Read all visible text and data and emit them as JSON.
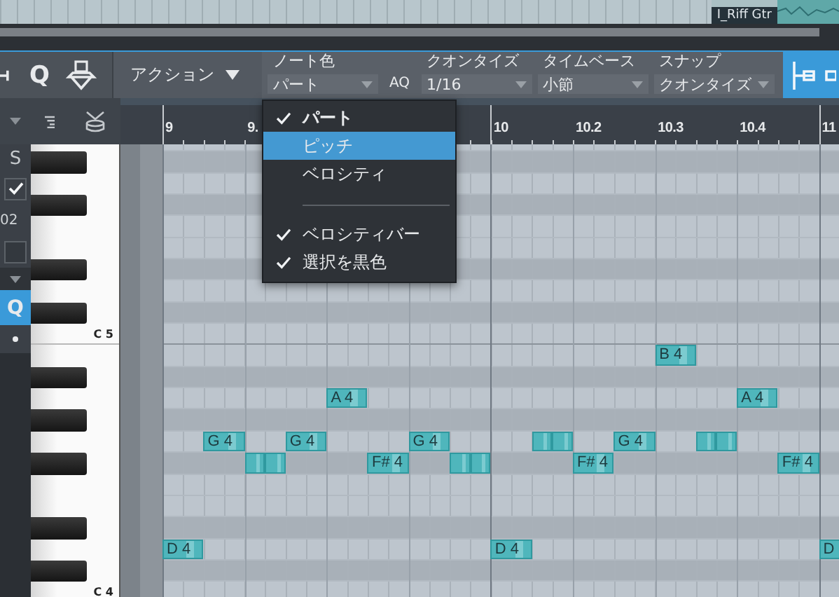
{
  "arrange_track": {
    "clip_label": "I_Riff Gtr"
  },
  "toolbar": {
    "tool_q": "Q",
    "action_menu": "アクション",
    "aq_button": "AQ",
    "fields": [
      {
        "label": "ノート色",
        "value": "パート"
      },
      {
        "label": "クオンタイズ",
        "value": "1/16"
      },
      {
        "label": "タイムベース",
        "value": "小節"
      },
      {
        "label": "スナップ",
        "value": "クオンタイズ"
      }
    ]
  },
  "note_color_menu": {
    "items": [
      {
        "kind": "option",
        "label": "パート",
        "checked": true,
        "selected": false
      },
      {
        "kind": "option",
        "label": "ピッチ",
        "checked": false,
        "selected": true
      },
      {
        "kind": "option",
        "label": "ベロシティ",
        "checked": false,
        "selected": false
      },
      {
        "kind": "separator"
      },
      {
        "kind": "option",
        "label": "ベロシティバー",
        "checked": true,
        "selected": false
      },
      {
        "kind": "option",
        "label": "選択を黒色",
        "checked": true,
        "selected": false
      }
    ]
  },
  "side_tools": [
    {
      "kind": "text-button",
      "label": "S"
    },
    {
      "kind": "checkbox",
      "checked": true
    },
    {
      "kind": "readout",
      "label": "02"
    },
    {
      "kind": "checkbox",
      "checked": false
    },
    {
      "kind": "collapse"
    },
    {
      "kind": "toggle",
      "label": "Q",
      "on": true
    },
    {
      "kind": "dot"
    }
  ],
  "ruler": {
    "beats": [
      {
        "kind": "bar",
        "label": "9"
      },
      {
        "kind": "beat",
        "label": "9."
      },
      {
        "kind": "covered"
      },
      {
        "kind": "covered"
      },
      {
        "kind": "bar",
        "label": "10"
      },
      {
        "kind": "beat",
        "label": "10.2"
      },
      {
        "kind": "beat",
        "label": "10.3"
      },
      {
        "kind": "beat",
        "label": "10.4"
      },
      {
        "kind": "bar",
        "label": "11"
      }
    ]
  },
  "lanes": [
    {
      "kind": "white"
    },
    {
      "kind": "black"
    },
    {
      "kind": "white"
    },
    {
      "kind": "black"
    },
    {
      "kind": "white"
    },
    {
      "kind": "white"
    },
    {
      "kind": "black"
    },
    {
      "kind": "white"
    },
    {
      "kind": "black"
    },
    {
      "kind": "white",
      "key_label": "C 5",
      "octave_line": true
    },
    {
      "kind": "white",
      "slots": [
        {
          "kind": "empty"
        },
        {
          "kind": "empty"
        },
        {
          "kind": "empty"
        },
        {
          "kind": "empty"
        },
        {
          "kind": "empty"
        },
        {
          "kind": "empty"
        },
        {
          "kind": "empty"
        },
        {
          "kind": "empty"
        },
        {
          "kind": "empty"
        },
        {
          "kind": "empty"
        },
        {
          "kind": "empty"
        },
        {
          "kind": "empty"
        },
        {
          "kind": "note",
          "label": "B 4"
        }
      ]
    },
    {
      "kind": "black"
    },
    {
      "kind": "white",
      "slots": [
        {
          "kind": "empty"
        },
        {
          "kind": "empty"
        },
        {
          "kind": "empty"
        },
        {
          "kind": "empty"
        },
        {
          "kind": "note",
          "label": "A 4"
        },
        {
          "kind": "empty"
        },
        {
          "kind": "empty"
        },
        {
          "kind": "empty"
        },
        {
          "kind": "empty"
        },
        {
          "kind": "empty"
        },
        {
          "kind": "empty"
        },
        {
          "kind": "empty"
        },
        {
          "kind": "empty"
        },
        {
          "kind": "empty"
        },
        {
          "kind": "note",
          "label": "A 4"
        }
      ]
    },
    {
      "kind": "black"
    },
    {
      "kind": "white",
      "slots": [
        {
          "kind": "empty"
        },
        {
          "kind": "note",
          "label": "G 4"
        },
        {
          "kind": "empty"
        },
        {
          "kind": "note",
          "label": "G 4"
        },
        {
          "kind": "empty"
        },
        {
          "kind": "empty"
        },
        {
          "kind": "note",
          "label": "G 4"
        },
        {
          "kind": "empty"
        },
        {
          "kind": "empty"
        },
        {
          "kind": "pair"
        },
        {
          "kind": "empty"
        },
        {
          "kind": "note",
          "label": "G 4"
        },
        {
          "kind": "empty"
        },
        {
          "kind": "pair"
        }
      ]
    },
    {
      "kind": "black",
      "slots": [
        {
          "kind": "empty"
        },
        {
          "kind": "empty"
        },
        {
          "kind": "pair"
        },
        {
          "kind": "empty"
        },
        {
          "kind": "empty"
        },
        {
          "kind": "note",
          "label": "F# 4"
        },
        {
          "kind": "empty"
        },
        {
          "kind": "pair"
        },
        {
          "kind": "empty"
        },
        {
          "kind": "empty"
        },
        {
          "kind": "note",
          "label": "F# 4"
        },
        {
          "kind": "empty"
        },
        {
          "kind": "empty"
        },
        {
          "kind": "empty"
        },
        {
          "kind": "empty"
        },
        {
          "kind": "note",
          "label": "F# 4"
        }
      ]
    },
    {
      "kind": "white"
    },
    {
      "kind": "white"
    },
    {
      "kind": "black"
    },
    {
      "kind": "white",
      "slots": [
        {
          "kind": "note",
          "label": "D 4"
        },
        {
          "kind": "empty"
        },
        {
          "kind": "empty"
        },
        {
          "kind": "empty"
        },
        {
          "kind": "empty"
        },
        {
          "kind": "empty"
        },
        {
          "kind": "empty"
        },
        {
          "kind": "empty"
        },
        {
          "kind": "note",
          "label": "D 4"
        },
        {
          "kind": "empty"
        },
        {
          "kind": "empty"
        },
        {
          "kind": "empty"
        },
        {
          "kind": "empty"
        },
        {
          "kind": "empty"
        },
        {
          "kind": "empty"
        },
        {
          "kind": "empty"
        },
        {
          "kind": "note",
          "label": "D"
        }
      ]
    },
    {
      "kind": "black"
    },
    {
      "kind": "white",
      "key_label": "C 4",
      "octave_line": true
    }
  ]
}
